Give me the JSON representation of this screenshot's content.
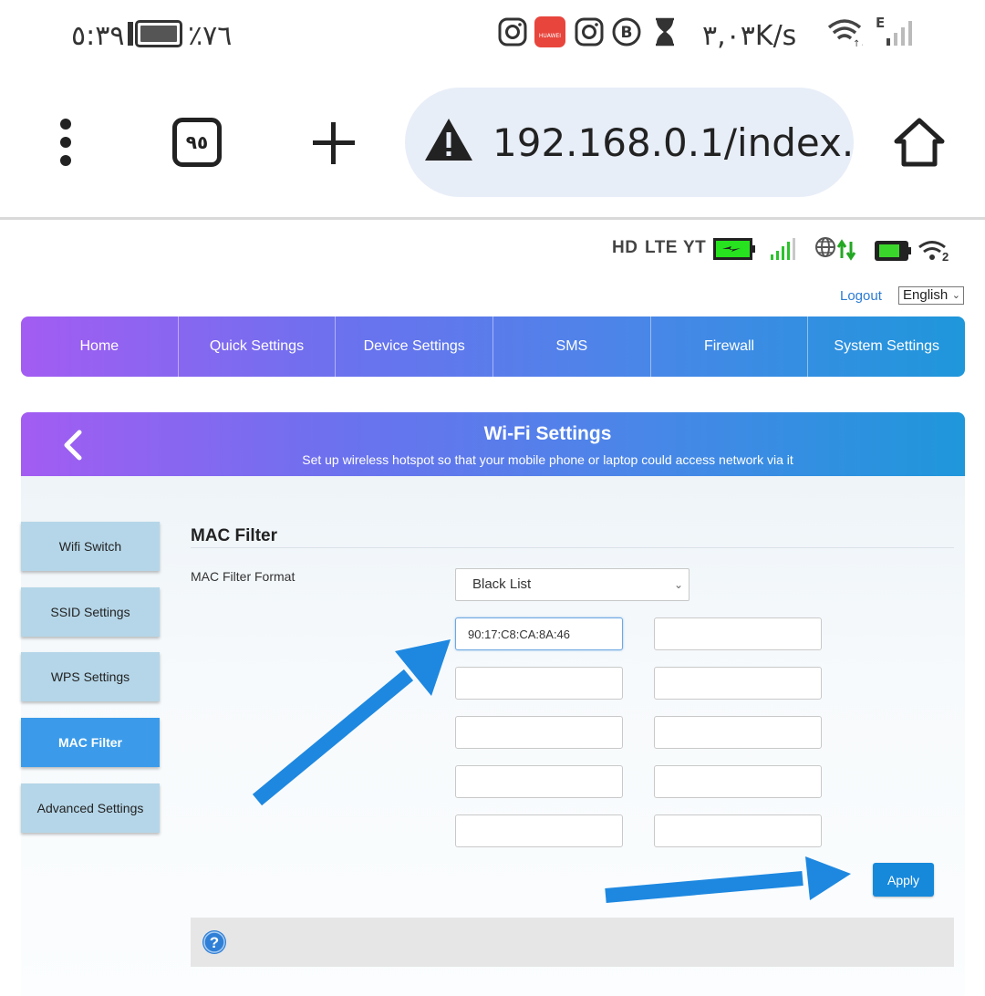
{
  "status_bar": {
    "time": "٥:٣٩",
    "battery_percent": "٪٧٦",
    "net_speed": "٣,٠٣K/s",
    "network_type": "E"
  },
  "browser": {
    "tab_count": "٩٥",
    "url": "192.168.0.1/index."
  },
  "router_status": {
    "hd": "HD",
    "lte": "LTE",
    "yt": "YT",
    "wifi_clients": "2"
  },
  "header": {
    "logout": "Logout",
    "language": "English"
  },
  "nav": [
    {
      "label": "Home"
    },
    {
      "label": "Quick Settings"
    },
    {
      "label": "Device Settings"
    },
    {
      "label": "SMS"
    },
    {
      "label": "Firewall"
    },
    {
      "label": "System Settings"
    }
  ],
  "wifi": {
    "title": "Wi-Fi Settings",
    "subtitle": "Set up wireless hotspot so that your mobile phone or laptop could access network via it"
  },
  "sidebar": [
    {
      "label": "Wifi Switch"
    },
    {
      "label": "SSID Settings"
    },
    {
      "label": "WPS Settings"
    },
    {
      "label": "MAC Filter",
      "active": true
    },
    {
      "label": "Advanced Settings"
    }
  ],
  "mac_filter": {
    "section_title": "MAC Filter",
    "format_label": "MAC Filter Format",
    "format_value": "Black List",
    "entries": [
      "90:17:C8:CA:8A:46",
      "",
      "",
      "",
      "",
      "",
      "",
      "",
      "",
      ""
    ],
    "apply_label": "Apply"
  },
  "colors": {
    "nav_gradient_start": "#a35cf2",
    "nav_gradient_end": "#1f97db",
    "active_tab": "#3b9bea",
    "sidebar_tab": "#b5d6e8",
    "apply_button": "#1689db",
    "annotation_arrow": "#1e88e0",
    "logout_link": "#2b7bd3"
  }
}
